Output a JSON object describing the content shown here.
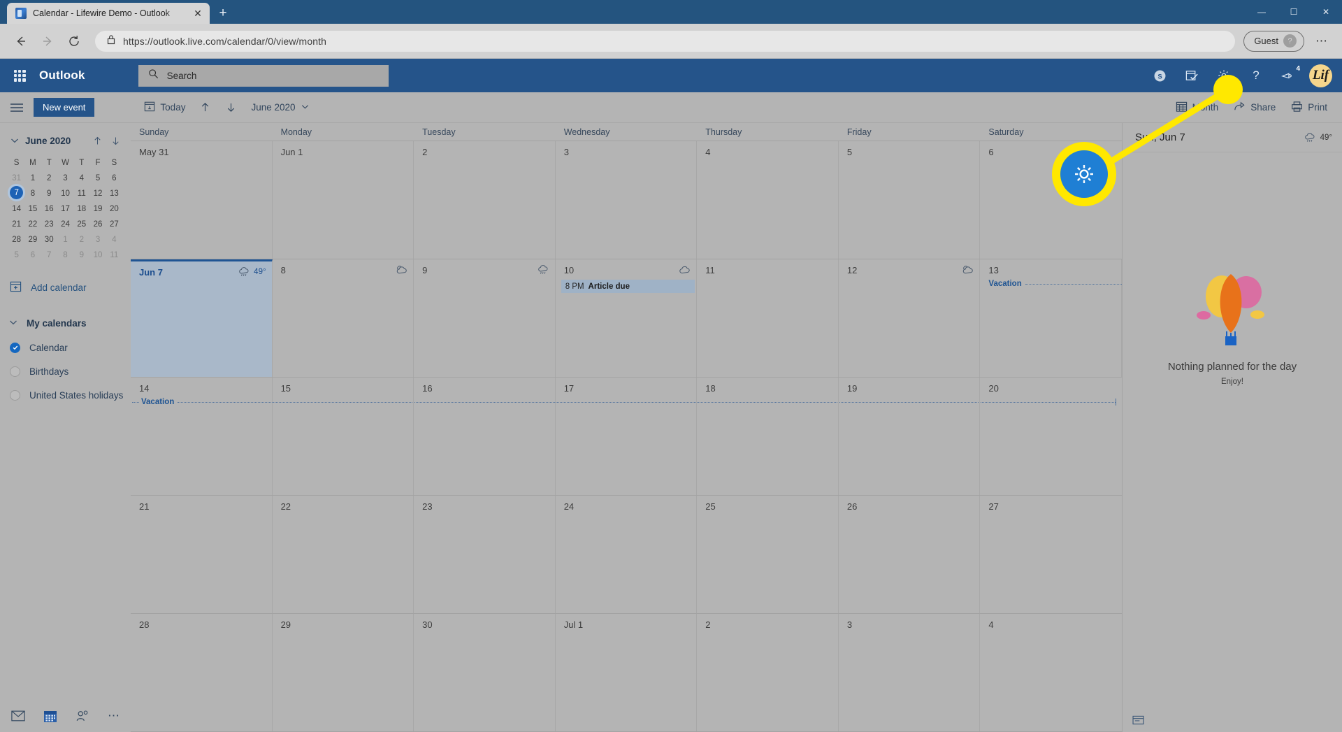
{
  "browser": {
    "tab": {
      "title": "Calendar - Lifewire Demo - Outlook",
      "close_label": "✕",
      "favicon": "outlook-favicon"
    },
    "new_tab_label": "+",
    "window_controls": {
      "minimize": "—",
      "maximize": "☐",
      "close": "✕"
    },
    "back_label": "←",
    "forward_label": "→",
    "reload_label": "⟳",
    "lock_icon": "lock-icon",
    "url": "https://outlook.live.com/calendar/0/view/month",
    "profile": {
      "label": "Guest",
      "avatar_glyph": "?"
    },
    "menu_label": "⋯"
  },
  "owa_header": {
    "brand": "Outlook",
    "search_placeholder": "Search",
    "icons": [
      {
        "name": "skype-icon",
        "glyph": "S"
      },
      {
        "name": "calendar-check-icon",
        "glyph": ""
      },
      {
        "name": "gear-icon",
        "glyph": ""
      },
      {
        "name": "help-icon",
        "glyph": "?"
      },
      {
        "name": "feedback-icon",
        "glyph": "",
        "badge": "4"
      }
    ],
    "avatar_initials": "Lif"
  },
  "commandbar": {
    "hamburger": "hamburger-icon",
    "new_event": "New event",
    "today": "Today",
    "prev": "↑",
    "next": "↓",
    "month_label": "June 2020",
    "month_chevron": "∨",
    "view": "Month",
    "share": "Share",
    "print": "Print"
  },
  "sidebar": {
    "mini_calendar": {
      "title": "June 2020",
      "prev": "↑",
      "next": "↓",
      "collapse": "∨",
      "dow": [
        "S",
        "M",
        "T",
        "W",
        "T",
        "F",
        "S"
      ],
      "weeks": [
        [
          {
            "n": "31",
            "out": true
          },
          {
            "n": "1"
          },
          {
            "n": "2"
          },
          {
            "n": "3"
          },
          {
            "n": "4"
          },
          {
            "n": "5"
          },
          {
            "n": "6"
          }
        ],
        [
          {
            "n": "7",
            "today": true
          },
          {
            "n": "8"
          },
          {
            "n": "9"
          },
          {
            "n": "10"
          },
          {
            "n": "11"
          },
          {
            "n": "12"
          },
          {
            "n": "13"
          }
        ],
        [
          {
            "n": "14"
          },
          {
            "n": "15"
          },
          {
            "n": "16"
          },
          {
            "n": "17"
          },
          {
            "n": "18"
          },
          {
            "n": "19"
          },
          {
            "n": "20"
          }
        ],
        [
          {
            "n": "21"
          },
          {
            "n": "22"
          },
          {
            "n": "23"
          },
          {
            "n": "24"
          },
          {
            "n": "25"
          },
          {
            "n": "26"
          },
          {
            "n": "27"
          }
        ],
        [
          {
            "n": "28"
          },
          {
            "n": "29"
          },
          {
            "n": "30"
          },
          {
            "n": "1",
            "out": true
          },
          {
            "n": "2",
            "out": true
          },
          {
            "n": "3",
            "out": true
          },
          {
            "n": "4",
            "out": true
          }
        ],
        [
          {
            "n": "5",
            "out": true
          },
          {
            "n": "6",
            "out": true
          },
          {
            "n": "7",
            "out": true
          },
          {
            "n": "8",
            "out": true
          },
          {
            "n": "9",
            "out": true
          },
          {
            "n": "10",
            "out": true
          },
          {
            "n": "11",
            "out": true
          }
        ]
      ]
    },
    "add_calendar": "Add calendar",
    "my_calendars_label": "My calendars",
    "calendars": [
      {
        "label": "Calendar",
        "checked": true
      },
      {
        "label": "Birthdays",
        "checked": false
      },
      {
        "label": "United States holidays",
        "checked": false
      }
    ],
    "bottom_apps": [
      {
        "name": "mail-icon"
      },
      {
        "name": "calendar-icon"
      },
      {
        "name": "people-icon"
      },
      {
        "name": "more-apps-icon",
        "glyph": "⋯"
      }
    ]
  },
  "calendar": {
    "dow_headers": [
      "Sunday",
      "Monday",
      "Tuesday",
      "Wednesday",
      "Thursday",
      "Friday",
      "Saturday"
    ],
    "weeks": [
      {
        "days": [
          {
            "label": "May 31"
          },
          {
            "label": "Jun 1"
          },
          {
            "label": "2"
          },
          {
            "label": "3"
          },
          {
            "label": "4"
          },
          {
            "label": "5"
          },
          {
            "label": "6"
          }
        ]
      },
      {
        "days": [
          {
            "label": "Jun 7",
            "selected": true,
            "weather": "rain",
            "temp": "49°"
          },
          {
            "label": "8",
            "weather": "partly-cloudy"
          },
          {
            "label": "9",
            "weather": "rain"
          },
          {
            "label": "10",
            "weather": "cloudy",
            "events": [
              {
                "time": "8 PM",
                "title": "Article due"
              }
            ]
          },
          {
            "label": "11"
          },
          {
            "label": "12",
            "weather": "partly-cloudy"
          },
          {
            "label": "13",
            "span_start": "Vacation"
          }
        ]
      },
      {
        "days": [
          {
            "label": "14",
            "span_continue": "Vacation"
          },
          {
            "label": "15"
          },
          {
            "label": "16"
          },
          {
            "label": "17"
          },
          {
            "label": "18"
          },
          {
            "label": "19"
          },
          {
            "label": "20"
          }
        ]
      },
      {
        "days": [
          {
            "label": "21"
          },
          {
            "label": "22"
          },
          {
            "label": "23"
          },
          {
            "label": "24"
          },
          {
            "label": "25"
          },
          {
            "label": "26"
          },
          {
            "label": "27"
          }
        ]
      },
      {
        "days": [
          {
            "label": "28"
          },
          {
            "label": "29"
          },
          {
            "label": "30"
          },
          {
            "label": "Jul 1"
          },
          {
            "label": "2"
          },
          {
            "label": "3"
          },
          {
            "label": "4"
          }
        ]
      }
    ]
  },
  "agenda": {
    "title": "Sun, Jun 7",
    "weather": "rain",
    "temp": "49°",
    "empty_title": "Nothing planned for the day",
    "empty_sub": "Enjoy!",
    "footer_icon": "add-event-icon"
  },
  "annotation": {
    "highlight_icon": "gear-icon",
    "ring_color": "#ffe800",
    "fill_color": "#1f7fd4",
    "dot_color": "#ffe800"
  }
}
